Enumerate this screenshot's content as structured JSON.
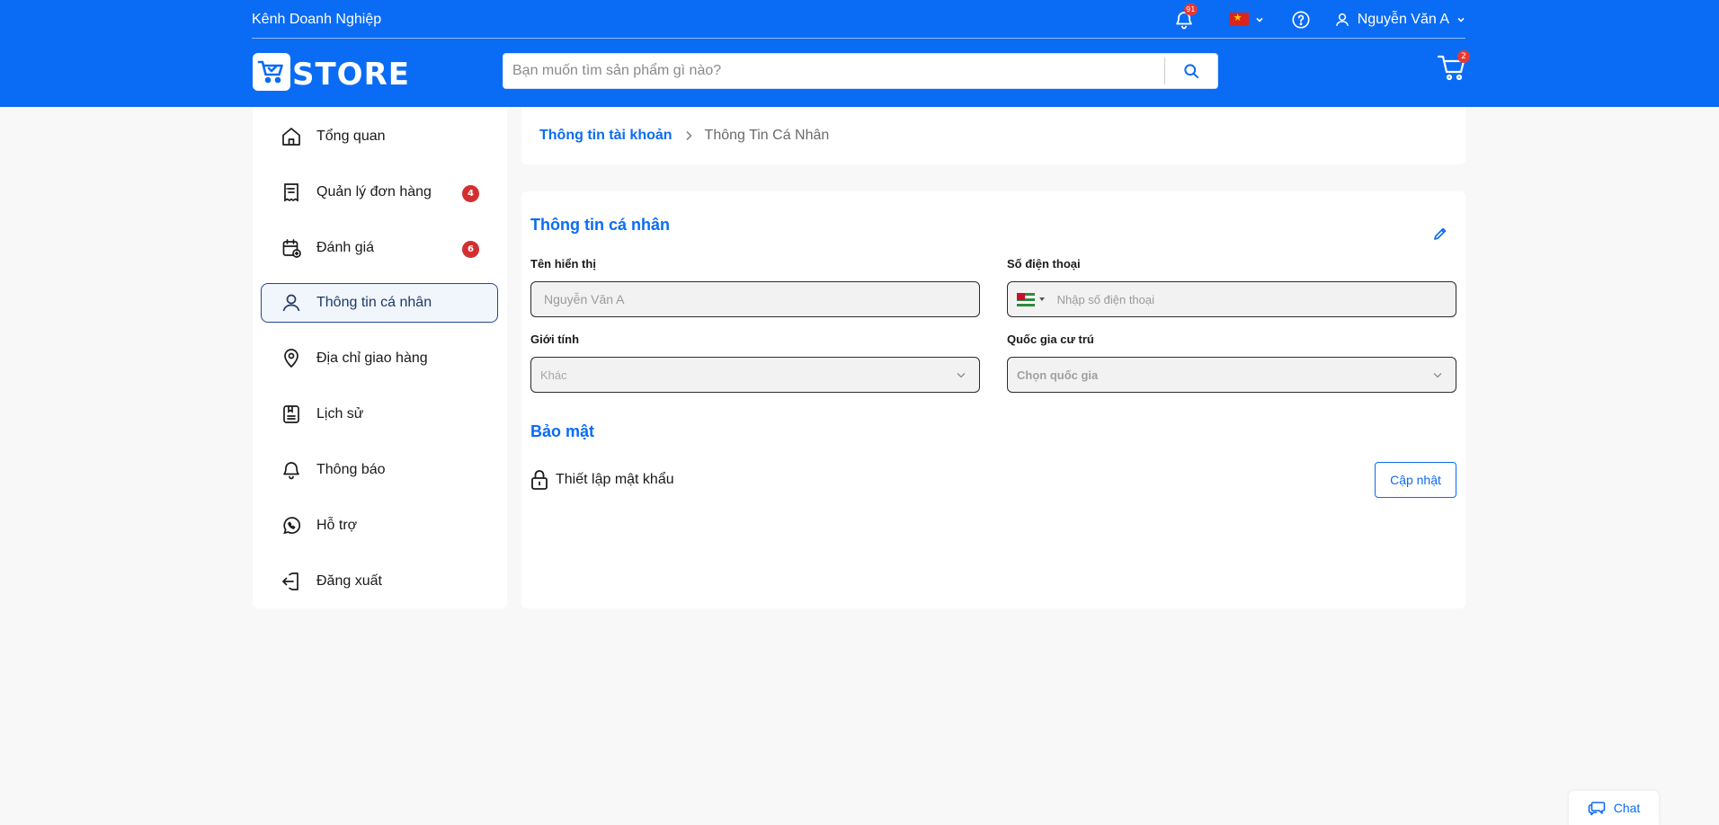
{
  "header": {
    "business_link": "Kênh Doanh Nghiệp",
    "notification_count": "91",
    "language_flag": "vn-flag-icon",
    "user_name": "Nguyễn Văn A",
    "logo_text": "STORE",
    "search_placeholder": "Bạn muốn tìm sản phẩm gì nào?",
    "cart_count": "2",
    "brand_color": "#0a6cf5"
  },
  "sidebar": {
    "items": [
      {
        "label": "Tổng quan",
        "icon": "home-icon"
      },
      {
        "label": "Quản lý đơn hàng",
        "icon": "receipt-icon",
        "badge": "4"
      },
      {
        "label": "Đánh giá",
        "icon": "calendar-review-icon",
        "badge": "6"
      },
      {
        "label": "Thông tin cá nhân",
        "icon": "user-icon",
        "active": true
      },
      {
        "label": "Địa chỉ giao hàng",
        "icon": "location-pin-icon"
      },
      {
        "label": "Lịch sử",
        "icon": "history-icon"
      },
      {
        "label": "Thông báo",
        "icon": "bell-icon"
      },
      {
        "label": "Hỗ trợ",
        "icon": "phone-support-icon"
      },
      {
        "label": "Đăng xuất",
        "icon": "logout-icon"
      }
    ]
  },
  "breadcrumb": {
    "parent": "Thông tin tài khoản",
    "current": "Thông Tin Cá Nhân"
  },
  "profile": {
    "section_title": "Thông tin cá nhân",
    "display_name_label": "Tên hiển thị",
    "display_name_placeholder": "Nguyễn Văn A",
    "phone_label": "Số điện thoại",
    "phone_placeholder": "Nhập số điện thoại",
    "gender_label": "Giới tính",
    "gender_value": "Khác",
    "country_label": "Quốc gia cư trú",
    "country_placeholder": "Chọn quốc gia"
  },
  "security": {
    "section_title": "Bảo mật",
    "password_label": "Thiết lập mật khẩu",
    "update_button": "Cập nhật"
  },
  "chat": {
    "label": "Chat"
  }
}
